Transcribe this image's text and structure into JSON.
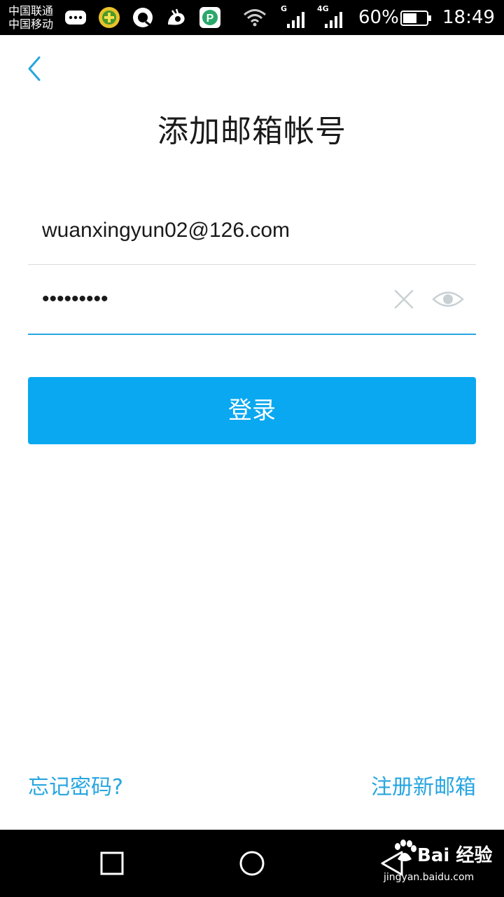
{
  "status_bar": {
    "carrier_1": "中国联通",
    "carrier_2": "中国移动",
    "notification_icons": [
      "message-icon",
      "game-icon",
      "qq-browser-icon",
      "uc-browser-icon",
      "parking-app-icon"
    ],
    "signal_1_label": "G",
    "signal_2_label": "4G",
    "battery_percent": "60%",
    "battery_level": 0.6,
    "time": "18:49"
  },
  "header": {
    "back_icon": "chevron-left-icon",
    "title": "添加邮箱帐号"
  },
  "form": {
    "email_value": "wuanxingyun02@126.com",
    "password_mask": "•••••••••",
    "clear_icon": "close-icon",
    "visibility_icon": "eye-icon",
    "login_label": "登录"
  },
  "footer": {
    "forgot_password": "忘记密码?",
    "register": "注册新邮箱"
  },
  "nav_bar": {
    "recents_icon": "square-icon",
    "home_icon": "circle-icon",
    "back_icon": "triangle-back-icon"
  },
  "watermark": {
    "brand": "Bai 经验",
    "url": "jingyan.baidu.com"
  },
  "colors": {
    "accent": "#0aa8f0",
    "link": "#27a6e0",
    "underline_active": "#27a6e0",
    "divider": "#dddddd",
    "icon_gray": "#c8d0d4"
  }
}
